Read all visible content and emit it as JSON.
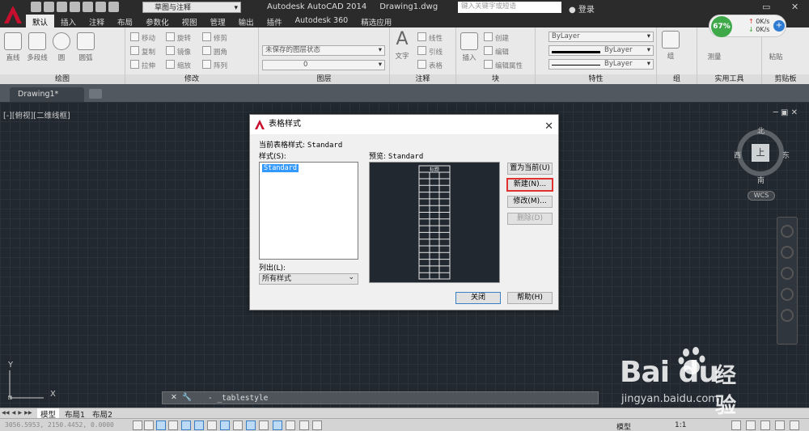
{
  "titlebar": {
    "workspace": "草图与注释",
    "app_title": "Autodesk AutoCAD 2014",
    "file_name": "Drawing1.dwg",
    "search_placeholder": "键入关键字或短语",
    "login": "登录"
  },
  "ribbon": {
    "tabs": [
      "默认",
      "插入",
      "注释",
      "布局",
      "参数化",
      "视图",
      "管理",
      "输出",
      "插件",
      "Autodesk 360",
      "精选应用"
    ],
    "panels": {
      "draw": {
        "title": "绘图",
        "tools": [
          "直线",
          "多段线",
          "圆",
          "圆弧"
        ]
      },
      "modify": {
        "title": "修改",
        "tools": [
          "移动",
          "旋转",
          "修剪",
          "复制",
          "镜像",
          "圆角",
          "拉伸",
          "缩放",
          "阵列"
        ]
      },
      "layers": {
        "title": "图层",
        "layer_state": "未保存的图层状态",
        "current_layer": "0"
      },
      "annotation": {
        "title": "注释",
        "text": "文字",
        "tools": [
          "线性",
          "引线",
          "表格"
        ]
      },
      "block": {
        "title": "块",
        "insert": "插入",
        "tools": [
          "创建",
          "编辑",
          "编辑属性"
        ]
      },
      "properties": {
        "title": "特性",
        "color": "ByLayer",
        "lineweight": "ByLayer",
        "linetype": "ByLayer"
      },
      "groups": {
        "title": "组",
        "group": "组"
      },
      "utilities": {
        "title": "实用工具",
        "measure": "测量"
      },
      "clipboard": {
        "title": "剪贴板",
        "paste": "粘贴"
      }
    }
  },
  "net_widget": {
    "percent": "67%",
    "up": "0K/s",
    "down": "0K/s"
  },
  "doc_tab": {
    "name": "Drawing1*"
  },
  "viewport": {
    "label": "[-][俯视][二维线框]",
    "compass": {
      "north": "北",
      "south": "南",
      "east": "东",
      "west": "西",
      "face": "上"
    },
    "wcs": "WCS",
    "ucs_y": "Y",
    "ucs_x": "X"
  },
  "command_line": {
    "prompt": "- _tablestyle"
  },
  "layout_tabs": [
    "模型",
    "布局1",
    "布局2"
  ],
  "statusbar": {
    "coords": "3056.5953, 2150.4452, 0.0000",
    "model": "模型",
    "scale": "1:1"
  },
  "dialog": {
    "title": "表格样式",
    "current_style_label": "当前表格样式:",
    "current_style_value": "Standard",
    "styles_label": "样式(S):",
    "styles": [
      "Standard"
    ],
    "preview_label": "预览:",
    "preview_value": "Standard",
    "preview_table_title": "标题",
    "list_label": "列出(L):",
    "list_value": "所有样式",
    "buttons": {
      "set_current": "置为当前(U)",
      "new": "新建(N)...",
      "modify": "修改(M)...",
      "delete": "删除(D)",
      "close": "关闭",
      "help": "帮助(H)"
    }
  },
  "watermark": {
    "logo": "Bai du",
    "cn": "经验",
    "url": "jingyan.baidu.com"
  },
  "colors": {
    "canvas": "#212830",
    "accent_red": "#c8102e",
    "selection_blue": "#3399ff",
    "highlight_border": "#e03030"
  }
}
